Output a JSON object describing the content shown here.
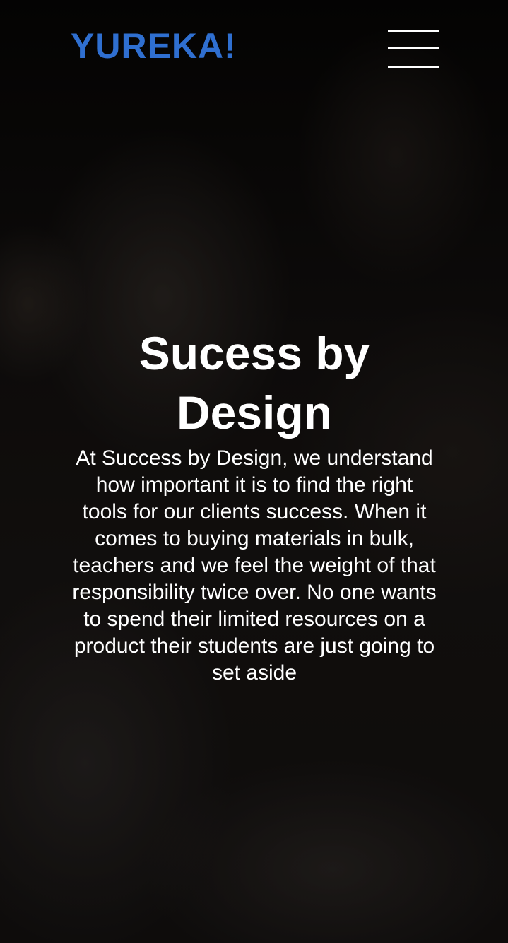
{
  "header": {
    "logo_text": "YUREKA!",
    "menu_icon": "hamburger-menu-icon"
  },
  "hero": {
    "title": "Sucess by Design",
    "body": "At Success by Design, we understand how important it is to find the right tools for our clients success. When it comes to buying materials in bulk, teachers and we feel the weight of that responsibility twice over. No one wants to spend their limited resources on a product their students are just going to set aside"
  },
  "colors": {
    "logo": "#2f6fd0",
    "text": "#ffffff",
    "background": "#0c0b0a"
  }
}
